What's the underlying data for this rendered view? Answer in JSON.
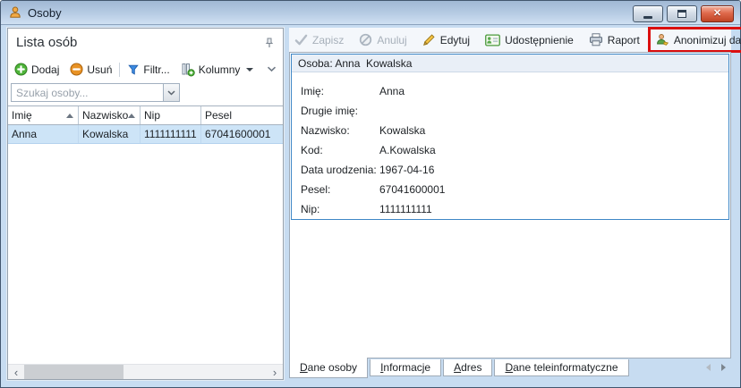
{
  "window": {
    "title": "Osoby"
  },
  "colors": {
    "annotation_red": "#db0f0f",
    "selection_blue": "#cde4f7",
    "detail_border_blue": "#3e87c6",
    "titlebar_top": "#a0b8d4",
    "titlebar_bottom": "#cfe0f2",
    "add_green": "#4fb43a",
    "remove_orange": "#e89225",
    "filter_blue": "#3c8ae0",
    "close_button_red": "#c04324"
  },
  "left_panel": {
    "title": "Lista osób",
    "toolbar": {
      "add_label": "Dodaj",
      "remove_label": "Usuń",
      "filter_label": "Filtr...",
      "columns_label": "Kolumny"
    },
    "search_placeholder": "Szukaj osoby...",
    "grid": {
      "columns": [
        "Imię",
        "Nazwisko",
        "Nip",
        "Pesel"
      ],
      "rows": [
        [
          "Anna",
          "Kowalska",
          "1111111111",
          "67041600001"
        ]
      ]
    }
  },
  "right_panel": {
    "toolbar": {
      "save_label": "Zapisz",
      "cancel_label": "Anuluj",
      "edit_label": "Edytuj",
      "share_label": "Udostępnienie",
      "report_label": "Raport",
      "anonymize_label": "Anonimizuj dane osoby"
    },
    "detail": {
      "header": "Osoba: Anna  Kowalska",
      "fields": [
        {
          "label": "Imię:",
          "value": "Anna"
        },
        {
          "label": "Drugie imię:",
          "value": ""
        },
        {
          "label": "Nazwisko:",
          "value": "Kowalska"
        },
        {
          "label": "Kod:",
          "value": "A.Kowalska"
        },
        {
          "label": "Data urodzenia:",
          "value": "1967-04-16"
        },
        {
          "label": "Pesel:",
          "value": "67041600001"
        },
        {
          "label": "Nip:",
          "value": "1111111111"
        }
      ]
    },
    "tabs": [
      {
        "label": "Dane osoby",
        "active": true
      },
      {
        "label": "Informacje",
        "active": false
      },
      {
        "label": "Adres",
        "active": false
      },
      {
        "label": "Dane teleinformatyczne",
        "active": false
      }
    ]
  },
  "icons": {
    "person-icon": "bust",
    "minimize-icon": "–",
    "restore-icon": "▣",
    "close-icon": "✕",
    "pin-icon": "push-pin",
    "add-icon": "+ green circle",
    "remove-icon": "− orange circle",
    "filter-icon": "funnel",
    "columns-icon": "columns + plus",
    "dropdown-chevron-icon": "⌄",
    "sort-asc-icon": "▲",
    "save-check-icon": "✓",
    "cancel-block-icon": "⊘",
    "edit-pencil-icon": "✎",
    "share-card-icon": "id-card",
    "report-printer-icon": "printer",
    "anonymize-person-icon": "person + pencil",
    "scroll-left-icon": "‹",
    "scroll-right-icon": "›",
    "tab-prev-icon": "◄",
    "tab-next-icon": "►"
  }
}
